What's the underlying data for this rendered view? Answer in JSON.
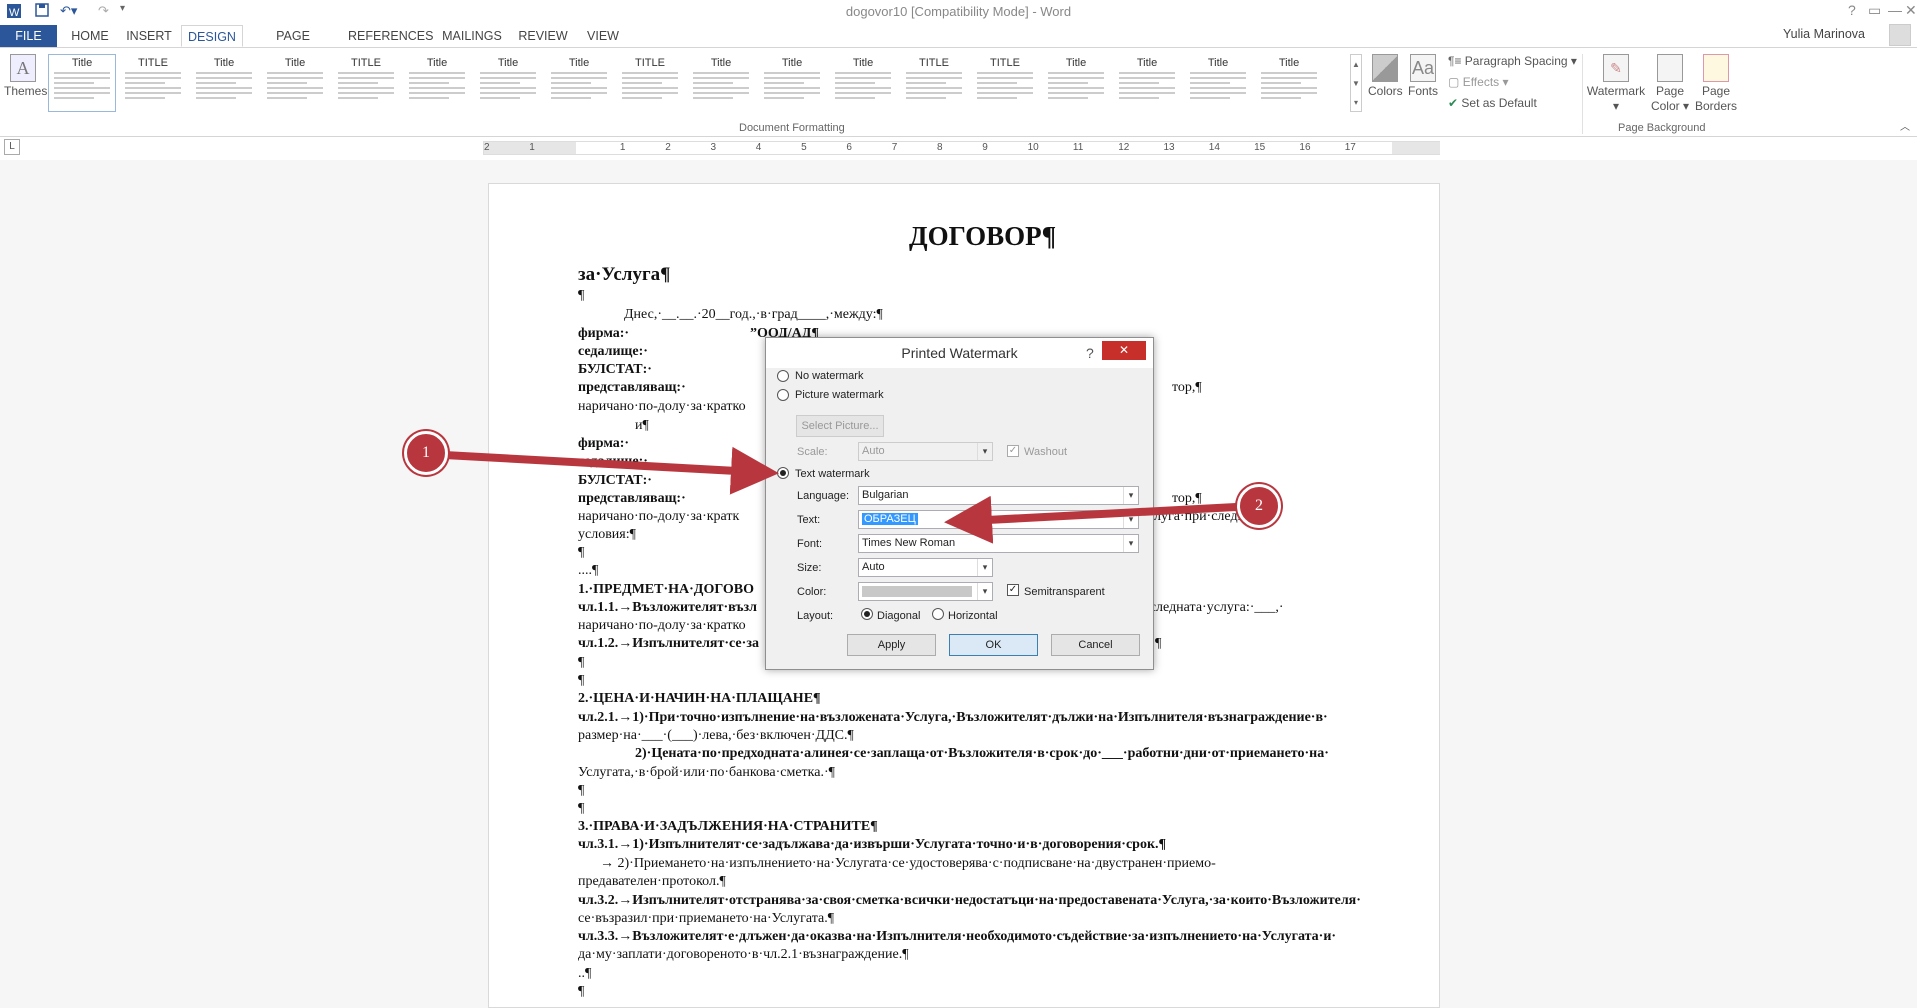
{
  "window": {
    "title": "dogovor10 [Compatibility Mode] - Word",
    "user": "Yulia Marinova",
    "controls": [
      "?",
      "▭",
      "—",
      "□",
      "✕"
    ]
  },
  "tabs": [
    "FILE",
    "HOME",
    "INSERT",
    "DESIGN",
    "PAGE LAYOUT",
    "REFERENCES",
    "MAILINGS",
    "REVIEW",
    "VIEW"
  ],
  "active_tab": "DESIGN",
  "ribbon": {
    "themes_label": "Themes",
    "gallery_titles": [
      "Title",
      "TITLE",
      "Title",
      "Title",
      "TITLE",
      "Title",
      "Title",
      "Title",
      "TITLE",
      "Title",
      "Title",
      "Title",
      "TITLE",
      "TITLE",
      "Title",
      "Title",
      "Title",
      "Title"
    ],
    "colors_label": "Colors",
    "fonts_label": "Fonts",
    "paragraph_spacing": "Paragraph Spacing",
    "effects": "Effects",
    "set_default": "Set as Default",
    "document_formatting": "Document Formatting",
    "watermark": "Watermark",
    "page_color": "Page Color",
    "page_borders": "Page Borders",
    "page_color_line1": "Page",
    "page_color_line2": "Color",
    "page_borders_line1": "Page",
    "page_borders_line2": "Borders",
    "page_background": "Page Background"
  },
  "ruler": {
    "ticks": [
      "2",
      "1",
      "",
      "1",
      "2",
      "3",
      "4",
      "5",
      "6",
      "7",
      "8",
      "9",
      "10",
      "11",
      "12",
      "13",
      "14",
      "15",
      "16",
      "17"
    ]
  },
  "document": {
    "lines": [
      "ДОГОВОР¶",
      "за·Услуга¶",
      "¶",
      "Днес,·__.__.·20__год.,·в·град____,·между:¶",
      "фирма:·",
      "седалище:·",
      "БУЛСТАТ:·",
      "представляващ:·",
      "наричано·по-долу·за·кратко",
      "и¶",
      "фирма:·",
      "седалище:·",
      "БУЛСТАТ:·",
      "представляващ:·",
      "наричано·по-долу·за·кратк",
      "условия:¶",
      "¶",
      "....¶",
      "1.·ПРЕДМЕТ·НА·ДОГОВО",
      "чл.1.1.→Възложителят·възл",
      "наричано·по-долу·за·кратко",
      "чл.1.2.→Изпълнителят·се·за",
      "¶",
      "¶",
      "2.·ЦЕНА·И·НАЧИН·НА·ПЛАЩАНЕ¶",
      "чл.2.1.→1)·При·точно·изпълнение·на·възложената·Услуга,·Възложителят·дължи·на·Изпълнителя·възнаграждение·в·",
      "размер·на·___·(___)·лева,·без·включен·ДДС.¶",
      "2)·Цената·по·предходната·алинея·се·заплаща·от·Възложителя·в·срок·до·___·работни·дни·от·приемането·на·",
      "Услугата,·в·брой·или·по·банкова·сметка.·¶",
      "¶",
      "¶",
      "3.·ПРАВА·И·ЗАДЪЛЖЕНИЯ·НА·СТРАНИТЕ¶",
      "чл.3.1.→1)·Изпълнителят·се·задължава·да·извърши·Услугата·точно·и·в·договорения·срок.¶",
      "→ 2)·Приемането·на·изпълнението·на·Услугата·се·удостоверява·с·подписване·на·двустранен·приемо-",
      "предавателен·протокол.¶",
      "чл.3.2.→Изпълнителят·отстранява·за·своя·сметка·всички·недостатъци·на·предоставената·Услуга,·за·които·Възложителя·",
      "се·възразил·при·приемането·на·Услугата.¶",
      "чл.3.3.→Възложителят·е·длъжен·да·оказва·на·Изпълнителя·необходимото·съдействие·за·изпълнението·на·Услугата·и·",
      "да·му·заплати·договореното·в·чл.2.1·възнаграждение.¶",
      "..¶",
      "¶"
    ],
    "right_fragments": {
      "r1": "”ООД/АД¶",
      "r2": "тор,¶",
      "r3": "тор,¶",
      "r4": "Договор·за·Услуга·при·следните·",
      "r5": "е,·да·извърши·следната·услуга:·___,·",
      "r6": "¶"
    }
  },
  "dialog": {
    "title": "Printed Watermark",
    "help": "?",
    "close": "✕",
    "no_watermark": "No watermark",
    "picture_watermark": "Picture watermark",
    "select_picture": "Select Picture...",
    "scale_label": "Scale:",
    "scale_value": "Auto",
    "washout": "Washout",
    "text_watermark": "Text watermark",
    "language_label": "Language:",
    "language_value": "Bulgarian",
    "text_label": "Text:",
    "text_value": "ОБРАЗЕЦ",
    "font_label": "Font:",
    "font_value": "Times New Roman",
    "size_label": "Size:",
    "size_value": "Auto",
    "color_label": "Color:",
    "semitransparent": "Semitransparent",
    "layout_label": "Layout:",
    "diagonal": "Diagonal",
    "horizontal": "Horizontal",
    "apply": "Apply",
    "ok": "OK",
    "cancel": "Cancel",
    "selected_type": "text",
    "selected_layout": "diagonal",
    "washout_checked": true,
    "semitransparent_checked": true
  },
  "annotations": {
    "badge1": "1",
    "badge2": "2",
    "color": "#b8373f"
  },
  "colors": {
    "accent": "#2b579a",
    "close_button": "#c7302a"
  }
}
